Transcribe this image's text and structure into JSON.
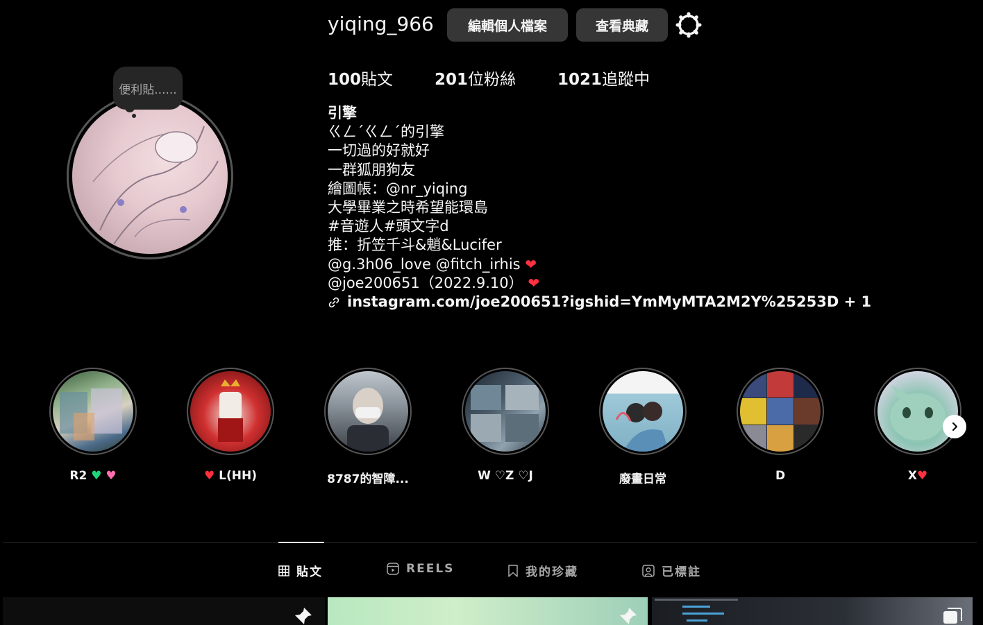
{
  "header": {
    "username": "yiqing_966",
    "edit_profile_label": "編輯個人檔案",
    "archive_label": "查看典藏"
  },
  "note": {
    "text": "便利貼......"
  },
  "stats": {
    "posts_count": "100",
    "posts_label": "貼文",
    "followers_count": "201",
    "followers_label": "位粉絲",
    "following_count": "1021",
    "following_label": "追蹤中"
  },
  "bio": {
    "name": "引擎",
    "lines": [
      "ㄍㄥˊㄍㄥˊ的引擎",
      "一切過的好就好",
      "一群狐朋狗友",
      "繪圖帳：@nr_yiqing",
      "大學畢業之時希望能環島",
      "#音遊人#頭文字d",
      "推：折笠千斗&魈&Lucifer"
    ],
    "mention1": "@g.3h06_love @fitch_irhis",
    "mention2": "@joe200651（2022.9.10）",
    "link": "instagram.com/joe200651?igshid=YmMyMTA2M2Y%25253D + 1"
  },
  "highlights": [
    {
      "label": "R2"
    },
    {
      "label": "L(HH)"
    },
    {
      "label": "8787的智障..."
    },
    {
      "label": "W ♡Z ♡J"
    },
    {
      "label": "廢畫日常"
    },
    {
      "label": "D"
    },
    {
      "label": "X"
    }
  ],
  "tabs": [
    {
      "label": "貼文"
    },
    {
      "label": "REELS"
    },
    {
      "label": "我的珍藏"
    },
    {
      "label": "已標註"
    }
  ],
  "colors": {
    "background": "#000000",
    "button": "#363636",
    "heart": "#ff3040",
    "green_heart": "#1fd57a",
    "pink_heart": "#ff6fae"
  }
}
